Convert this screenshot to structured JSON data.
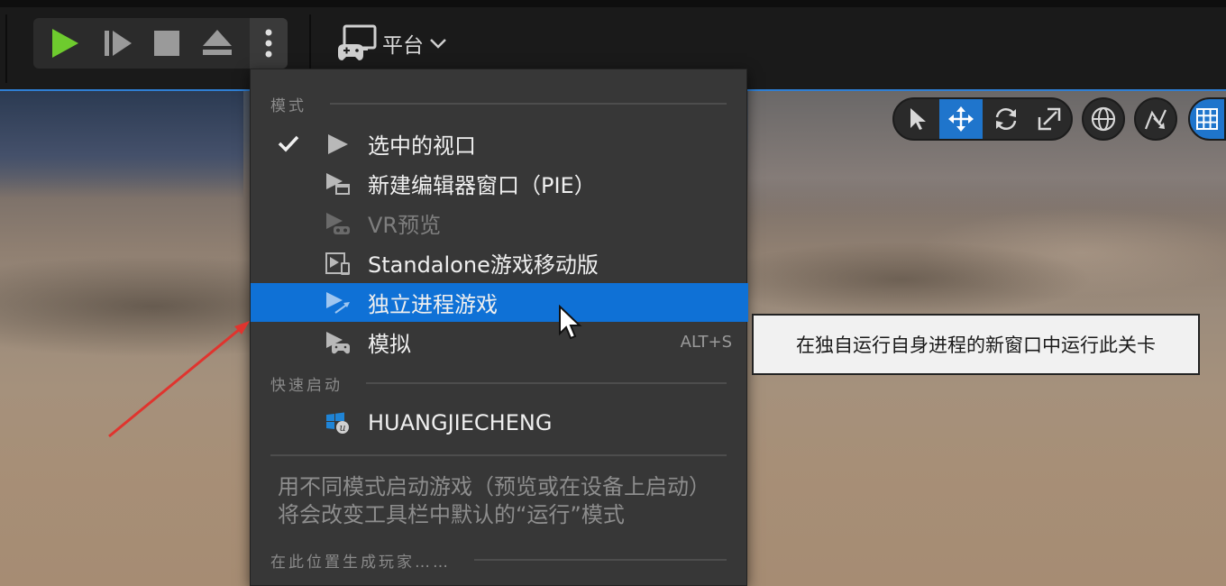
{
  "toolbar": {
    "play_icon": "play-icon",
    "advance_icon": "frame-advance-icon",
    "stop_icon": "stop-icon",
    "eject_icon": "eject-icon",
    "more_icon": "more-vertical-icon",
    "platform_label": "平台",
    "accent_play": "#6ecb2e"
  },
  "viewport_toolbar": {
    "tools": [
      "select-icon",
      "move-icon",
      "rotate-icon",
      "scale-icon"
    ],
    "active_tool": "move-icon",
    "extra": [
      "world-space-icon",
      "surface-snap-icon",
      "grid-icon"
    ],
    "accent": "#1f75cc"
  },
  "menu": {
    "section_mode": "模式",
    "items": [
      {
        "label": "选中的视口",
        "checked": true
      },
      {
        "label": "新建编辑器窗口（PIE）"
      },
      {
        "label": "VR预览",
        "disabled": true
      },
      {
        "label": "Standalone游戏移动版"
      },
      {
        "label": "独立进程游戏",
        "highlighted": true
      },
      {
        "label": "模拟",
        "shortcut": "ALT+S"
      }
    ],
    "section_quick": "快速启动",
    "quick_item": "HUANGJIECHENG",
    "hint": "用不同模式启动游戏（预览或在设备上启动）将会改变工具栏中默认的“运行”模式",
    "section_spawn": "在此位置生成玩家……",
    "highlight_color": "#0f71d6"
  },
  "tooltip": {
    "text": "在独自运行自身进程的新窗口中运行此关卡"
  }
}
